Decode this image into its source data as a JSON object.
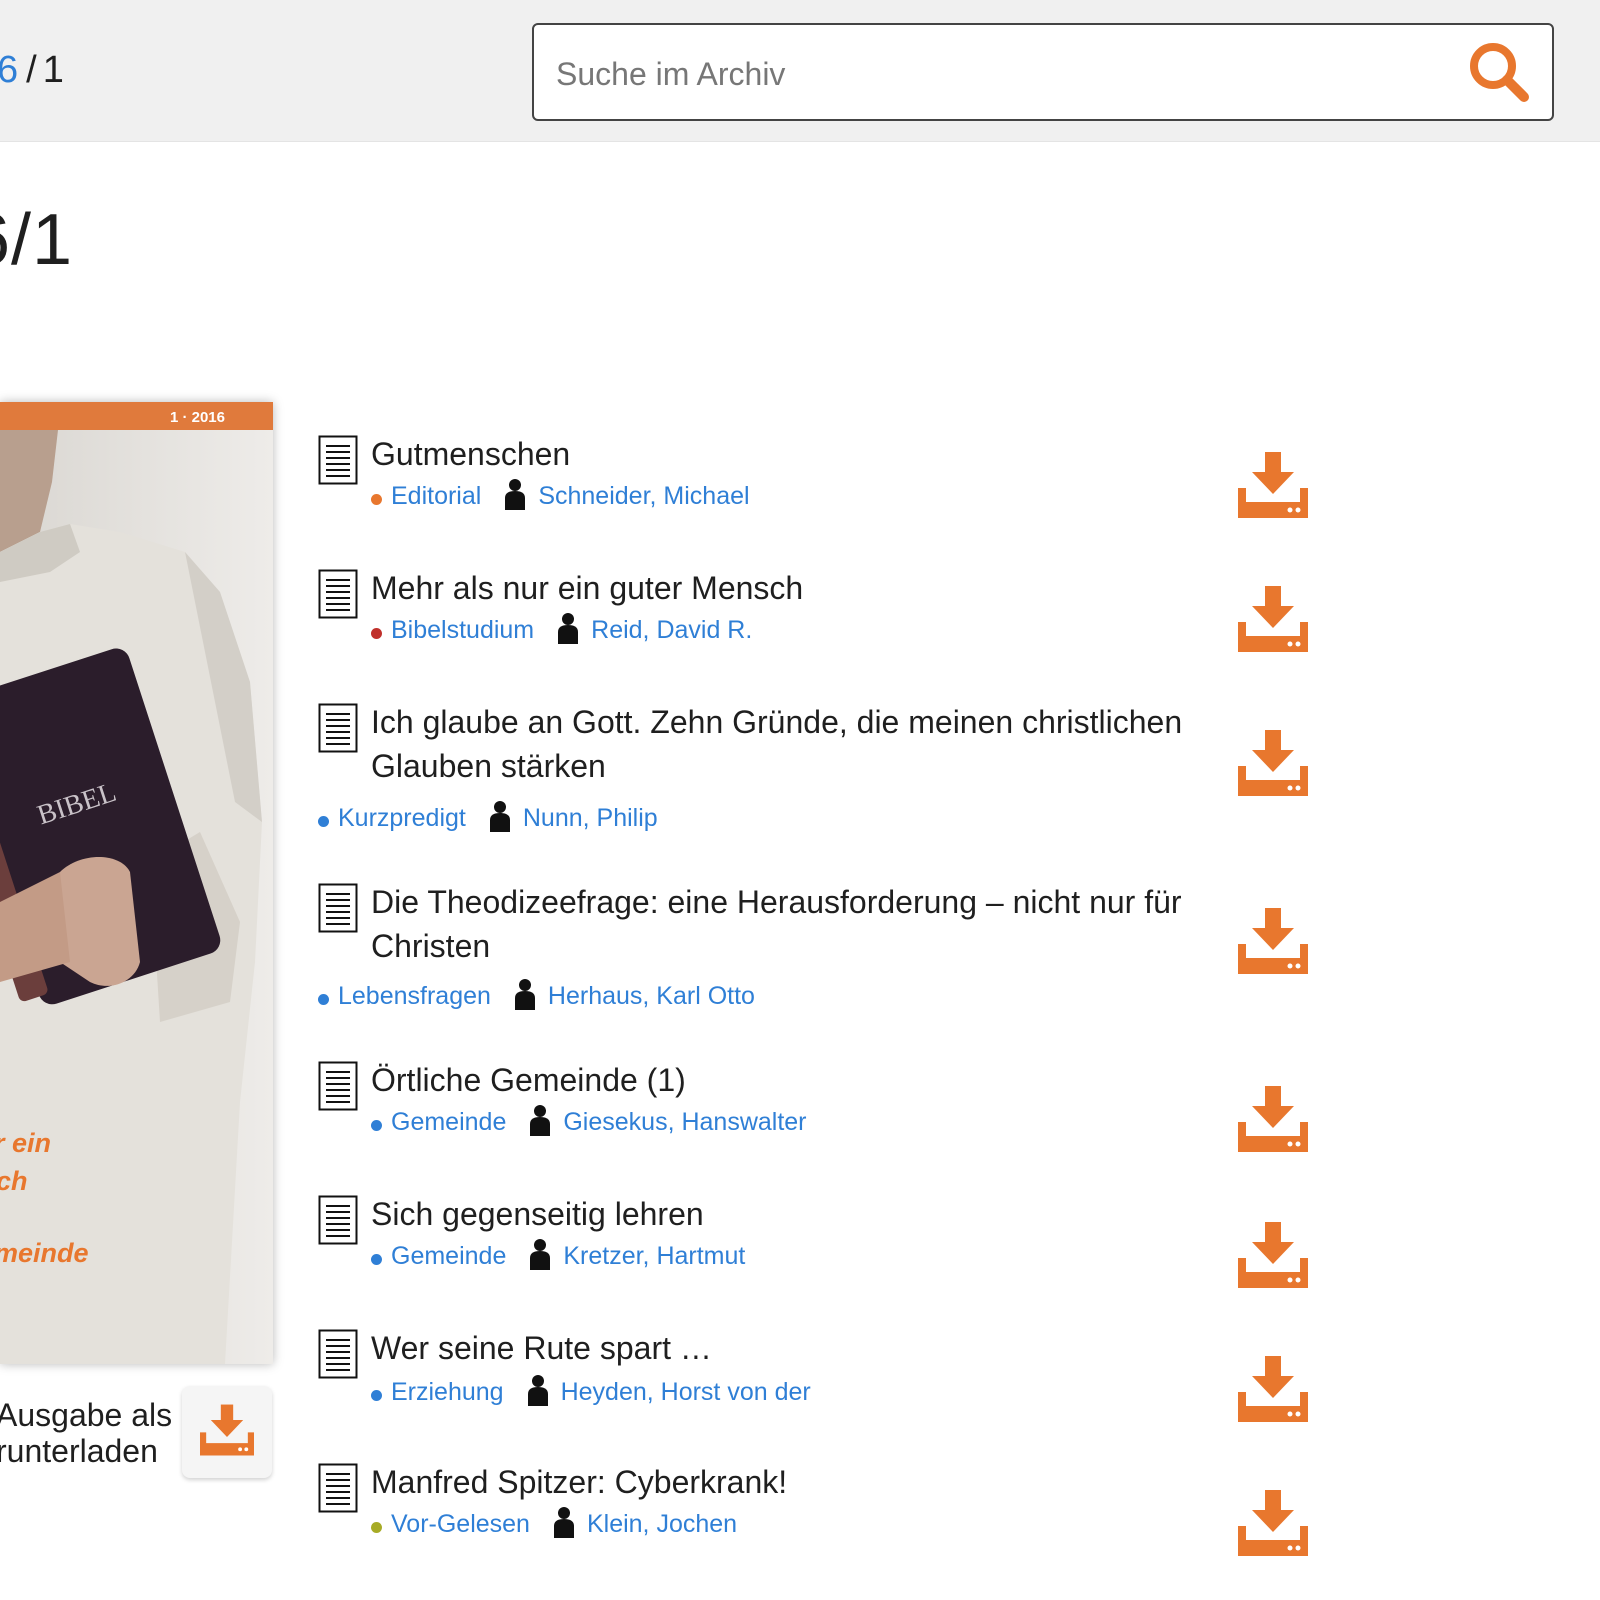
{
  "header": {
    "breadcrumb_current": "6",
    "breadcrumb_separator": "/",
    "breadcrumb_total": "1"
  },
  "search": {
    "placeholder": "Suche im Archiv",
    "value": ""
  },
  "page": {
    "title": "6/1"
  },
  "cover": {
    "issue_label": "1 · 2016",
    "bible_text": "BIBEL",
    "caption_lines": [
      "r ein",
      "ch",
      "meinde"
    ]
  },
  "issue_download": {
    "label_line1": "Ausgabe als",
    "label_line2": "runterladen"
  },
  "colors": {
    "accent": "#e8772e",
    "link": "#2f7fd6",
    "category_editorial": "#e8772e",
    "category_bibelstudium": "#c0302b",
    "category_default": "#2f7fd6",
    "category_vorgelesen": "#a7ab26"
  },
  "icons": {
    "search": "search-icon",
    "document": "document-icon",
    "person": "person-icon",
    "download": "download-icon"
  },
  "articles": [
    {
      "title": "Gutmenschen",
      "category": "Editorial",
      "author": "Schneider, Michael"
    },
    {
      "title": "Mehr als nur ein guter Mensch",
      "category": "Bibelstudium",
      "author": "Reid, David R."
    },
    {
      "title": "Ich glaube an Gott. Zehn Gründe, die meinen christlichen Glauben stärken",
      "category": "Kurzpredigt",
      "author": "Nunn, Philip"
    },
    {
      "title": "Die Theodizeefrage: eine Herausforderung – nicht nur für Christen",
      "category": "Lebensfragen",
      "author": "Herhaus, Karl Otto"
    },
    {
      "title": "Örtliche Gemeinde (1)",
      "category": "Gemeinde",
      "author": "Giesekus, Hanswalter"
    },
    {
      "title": "Sich gegenseitig lehren",
      "category": "Gemeinde",
      "author": "Kretzer, Hartmut"
    },
    {
      "title": "Wer seine Rute spart …",
      "category": "Erziehung",
      "author": "Heyden, Horst von der"
    },
    {
      "title": "Manfred Spitzer: Cyberkrank!",
      "category": "Vor-Gelesen",
      "author": "Klein, Jochen"
    }
  ]
}
